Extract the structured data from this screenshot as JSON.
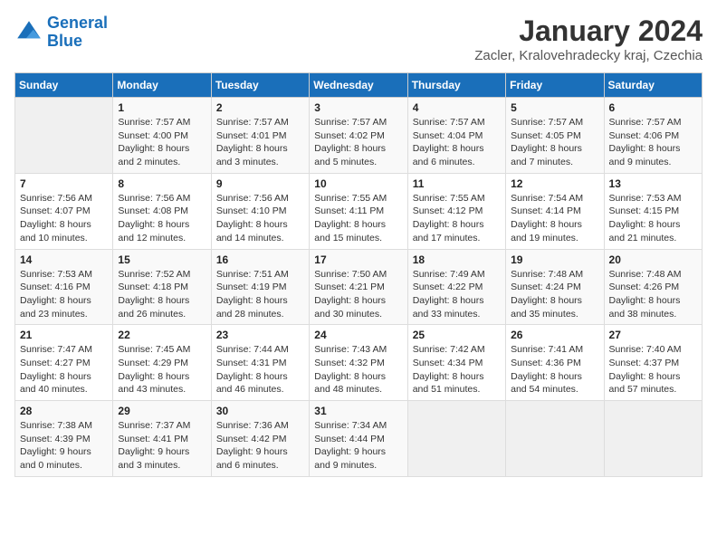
{
  "logo": {
    "line1": "General",
    "line2": "Blue"
  },
  "title": "January 2024",
  "subtitle": "Zacler, Kralovehradecky kraj, Czechia",
  "days_of_week": [
    "Sunday",
    "Monday",
    "Tuesday",
    "Wednesday",
    "Thursday",
    "Friday",
    "Saturday"
  ],
  "weeks": [
    [
      {
        "day": "",
        "sunrise": "",
        "sunset": "",
        "daylight": ""
      },
      {
        "day": "1",
        "sunrise": "Sunrise: 7:57 AM",
        "sunset": "Sunset: 4:00 PM",
        "daylight": "Daylight: 8 hours and 2 minutes."
      },
      {
        "day": "2",
        "sunrise": "Sunrise: 7:57 AM",
        "sunset": "Sunset: 4:01 PM",
        "daylight": "Daylight: 8 hours and 3 minutes."
      },
      {
        "day": "3",
        "sunrise": "Sunrise: 7:57 AM",
        "sunset": "Sunset: 4:02 PM",
        "daylight": "Daylight: 8 hours and 5 minutes."
      },
      {
        "day": "4",
        "sunrise": "Sunrise: 7:57 AM",
        "sunset": "Sunset: 4:04 PM",
        "daylight": "Daylight: 8 hours and 6 minutes."
      },
      {
        "day": "5",
        "sunrise": "Sunrise: 7:57 AM",
        "sunset": "Sunset: 4:05 PM",
        "daylight": "Daylight: 8 hours and 7 minutes."
      },
      {
        "day": "6",
        "sunrise": "Sunrise: 7:57 AM",
        "sunset": "Sunset: 4:06 PM",
        "daylight": "Daylight: 8 hours and 9 minutes."
      }
    ],
    [
      {
        "day": "7",
        "sunrise": "Sunrise: 7:56 AM",
        "sunset": "Sunset: 4:07 PM",
        "daylight": "Daylight: 8 hours and 10 minutes."
      },
      {
        "day": "8",
        "sunrise": "Sunrise: 7:56 AM",
        "sunset": "Sunset: 4:08 PM",
        "daylight": "Daylight: 8 hours and 12 minutes."
      },
      {
        "day": "9",
        "sunrise": "Sunrise: 7:56 AM",
        "sunset": "Sunset: 4:10 PM",
        "daylight": "Daylight: 8 hours and 14 minutes."
      },
      {
        "day": "10",
        "sunrise": "Sunrise: 7:55 AM",
        "sunset": "Sunset: 4:11 PM",
        "daylight": "Daylight: 8 hours and 15 minutes."
      },
      {
        "day": "11",
        "sunrise": "Sunrise: 7:55 AM",
        "sunset": "Sunset: 4:12 PM",
        "daylight": "Daylight: 8 hours and 17 minutes."
      },
      {
        "day": "12",
        "sunrise": "Sunrise: 7:54 AM",
        "sunset": "Sunset: 4:14 PM",
        "daylight": "Daylight: 8 hours and 19 minutes."
      },
      {
        "day": "13",
        "sunrise": "Sunrise: 7:53 AM",
        "sunset": "Sunset: 4:15 PM",
        "daylight": "Daylight: 8 hours and 21 minutes."
      }
    ],
    [
      {
        "day": "14",
        "sunrise": "Sunrise: 7:53 AM",
        "sunset": "Sunset: 4:16 PM",
        "daylight": "Daylight: 8 hours and 23 minutes."
      },
      {
        "day": "15",
        "sunrise": "Sunrise: 7:52 AM",
        "sunset": "Sunset: 4:18 PM",
        "daylight": "Daylight: 8 hours and 26 minutes."
      },
      {
        "day": "16",
        "sunrise": "Sunrise: 7:51 AM",
        "sunset": "Sunset: 4:19 PM",
        "daylight": "Daylight: 8 hours and 28 minutes."
      },
      {
        "day": "17",
        "sunrise": "Sunrise: 7:50 AM",
        "sunset": "Sunset: 4:21 PM",
        "daylight": "Daylight: 8 hours and 30 minutes."
      },
      {
        "day": "18",
        "sunrise": "Sunrise: 7:49 AM",
        "sunset": "Sunset: 4:22 PM",
        "daylight": "Daylight: 8 hours and 33 minutes."
      },
      {
        "day": "19",
        "sunrise": "Sunrise: 7:48 AM",
        "sunset": "Sunset: 4:24 PM",
        "daylight": "Daylight: 8 hours and 35 minutes."
      },
      {
        "day": "20",
        "sunrise": "Sunrise: 7:48 AM",
        "sunset": "Sunset: 4:26 PM",
        "daylight": "Daylight: 8 hours and 38 minutes."
      }
    ],
    [
      {
        "day": "21",
        "sunrise": "Sunrise: 7:47 AM",
        "sunset": "Sunset: 4:27 PM",
        "daylight": "Daylight: 8 hours and 40 minutes."
      },
      {
        "day": "22",
        "sunrise": "Sunrise: 7:45 AM",
        "sunset": "Sunset: 4:29 PM",
        "daylight": "Daylight: 8 hours and 43 minutes."
      },
      {
        "day": "23",
        "sunrise": "Sunrise: 7:44 AM",
        "sunset": "Sunset: 4:31 PM",
        "daylight": "Daylight: 8 hours and 46 minutes."
      },
      {
        "day": "24",
        "sunrise": "Sunrise: 7:43 AM",
        "sunset": "Sunset: 4:32 PM",
        "daylight": "Daylight: 8 hours and 48 minutes."
      },
      {
        "day": "25",
        "sunrise": "Sunrise: 7:42 AM",
        "sunset": "Sunset: 4:34 PM",
        "daylight": "Daylight: 8 hours and 51 minutes."
      },
      {
        "day": "26",
        "sunrise": "Sunrise: 7:41 AM",
        "sunset": "Sunset: 4:36 PM",
        "daylight": "Daylight: 8 hours and 54 minutes."
      },
      {
        "day": "27",
        "sunrise": "Sunrise: 7:40 AM",
        "sunset": "Sunset: 4:37 PM",
        "daylight": "Daylight: 8 hours and 57 minutes."
      }
    ],
    [
      {
        "day": "28",
        "sunrise": "Sunrise: 7:38 AM",
        "sunset": "Sunset: 4:39 PM",
        "daylight": "Daylight: 9 hours and 0 minutes."
      },
      {
        "day": "29",
        "sunrise": "Sunrise: 7:37 AM",
        "sunset": "Sunset: 4:41 PM",
        "daylight": "Daylight: 9 hours and 3 minutes."
      },
      {
        "day": "30",
        "sunrise": "Sunrise: 7:36 AM",
        "sunset": "Sunset: 4:42 PM",
        "daylight": "Daylight: 9 hours and 6 minutes."
      },
      {
        "day": "31",
        "sunrise": "Sunrise: 7:34 AM",
        "sunset": "Sunset: 4:44 PM",
        "daylight": "Daylight: 9 hours and 9 minutes."
      },
      {
        "day": "",
        "sunrise": "",
        "sunset": "",
        "daylight": ""
      },
      {
        "day": "",
        "sunrise": "",
        "sunset": "",
        "daylight": ""
      },
      {
        "day": "",
        "sunrise": "",
        "sunset": "",
        "daylight": ""
      }
    ]
  ]
}
